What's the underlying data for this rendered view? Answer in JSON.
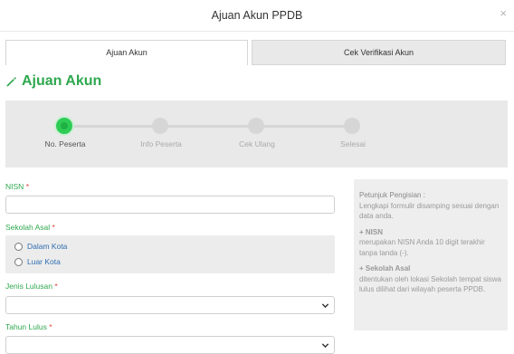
{
  "modal": {
    "title": "Ajuan Akun PPDB",
    "close_label": "×"
  },
  "tabs": [
    {
      "label": "Ajuan Akun",
      "active": true
    },
    {
      "label": "Cek Verifikasi Akun",
      "active": false
    }
  ],
  "section": {
    "title": "Ajuan Akun",
    "icon": "pencil-icon"
  },
  "stepper": {
    "current_step": 1,
    "steps": [
      {
        "label": "No. Peserta"
      },
      {
        "label": "Info Peserta"
      },
      {
        "label": "Cek Ulang"
      },
      {
        "label": "Selesai"
      }
    ],
    "active_color": "#2ecc55"
  },
  "form": {
    "nisn": {
      "label": "NISN",
      "required_mark": "*",
      "value": ""
    },
    "sekolah_asal": {
      "label": "Sekolah Asal",
      "required_mark": "*",
      "options": [
        {
          "label": "Dalam Kota"
        },
        {
          "label": "Luar Kota"
        }
      ]
    },
    "jenis_lulusan": {
      "label": "Jenis Lulusan",
      "required_mark": "*",
      "value": ""
    },
    "tahun_lulus": {
      "label": "Tahun Lulus",
      "required_mark": "*",
      "value": ""
    }
  },
  "help": {
    "title": "Petunjuk Pengisian :",
    "intro": "Lengkapi formulir disamping sesuai dengan data anda.",
    "nisn_heading": "+ NISN",
    "nisn_text": "merupakan NISN Anda 10 digit terakhir tanpa tanda (-).",
    "sekolah_heading": "+ Sekolah Asal",
    "sekolah_text": "ditentukan oleh lokasi Sekolah tempat siswa lulus dilihat dari wilayah peserta PPDB."
  },
  "colors": {
    "accent": "#2fa84f",
    "required": "#e0453a",
    "link": "#2f6fb0"
  }
}
